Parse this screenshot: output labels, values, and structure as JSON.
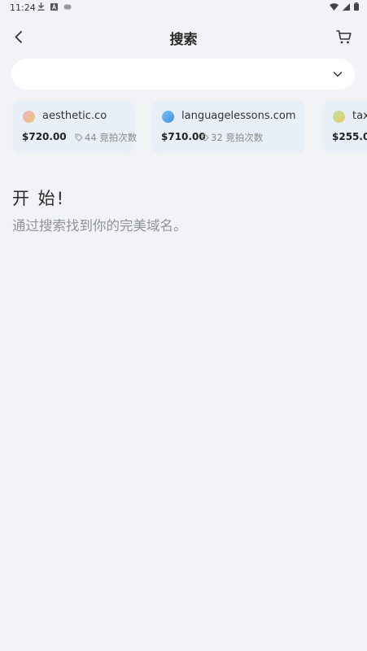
{
  "status_bar": {
    "time": "11:24"
  },
  "header": {
    "title": "搜索"
  },
  "search": {
    "placeholder": ""
  },
  "cards": [
    {
      "domain": "aesthetic.co",
      "price": "$720.00",
      "bids": "44 竞拍次数",
      "dot_colors": [
        "#f3b2c0",
        "#e7c479"
      ]
    },
    {
      "domain": "languagelessons.com",
      "price": "$710.00",
      "bids": "32 竞拍次数",
      "dot_colors": [
        "#7ec1f3",
        "#3e8fe0"
      ]
    },
    {
      "domain": "tax",
      "price": "$255.0",
      "bids": "",
      "dot_colors": [
        "#b5e39a",
        "#f2c86b"
      ]
    }
  ],
  "empty_state": {
    "title": "开 始!",
    "subtitle": "通过搜索找到你的完美域名。"
  }
}
